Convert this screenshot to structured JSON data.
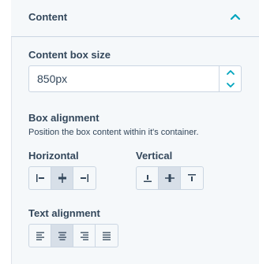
{
  "section": {
    "title": "Content",
    "collapse_icon": "chevron-up-icon"
  },
  "content_box_size": {
    "label": "Content box size",
    "value": "850px"
  },
  "box_alignment": {
    "label": "Box alignment",
    "help": "Position the box content within it's container.",
    "horizontal": {
      "label": "Horizontal",
      "options": [
        "align-left-icon",
        "align-center-horizontal-icon",
        "align-right-icon"
      ],
      "selected": 1
    },
    "vertical": {
      "label": "Vertical",
      "options": [
        "align-bottom-icon",
        "align-middle-vertical-icon",
        "align-top-icon"
      ],
      "selected": 1
    }
  },
  "text_alignment": {
    "label": "Text alignment",
    "options": [
      "text-align-left-icon",
      "text-align-center-icon",
      "text-align-right-icon",
      "text-align-justify-icon"
    ],
    "selected": 1
  },
  "colors": {
    "accent": "#00a4bd",
    "text": "#33475b",
    "panel": "#f5f8fa",
    "border": "#cbd6e2",
    "active": "#d7dfe8"
  }
}
